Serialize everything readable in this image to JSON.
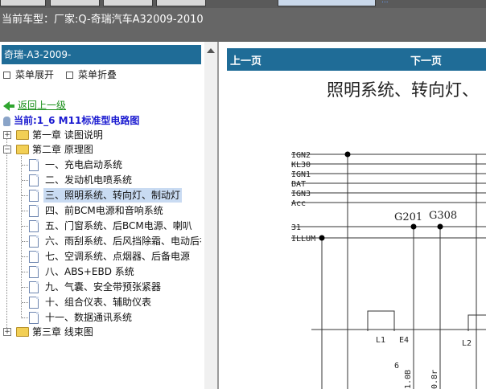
{
  "window": {
    "title": "当前车型：厂家:Q-奇瑞汽车A32009-2010",
    "top_link": "..."
  },
  "sidebar": {
    "header": "奇瑞-A3-2009-",
    "menu_expand": "菜单展开",
    "menu_collapse": "菜单折叠",
    "back_label": "返回上一级",
    "current_label": "当前:1_6 M11标准型电路图",
    "tree": [
      {
        "label": "第一章 读图说明",
        "type": "folder",
        "expanded": false
      },
      {
        "label": "第二章 原理图",
        "type": "folder",
        "expanded": true,
        "children": [
          {
            "label": "一、充电启动系统"
          },
          {
            "label": "二、发动机电喷系统"
          },
          {
            "label": "三、照明系统、转向灯、制动灯",
            "selected": true
          },
          {
            "label": "四、前BCM电源和音响系统"
          },
          {
            "label": "五、门窗系统、后BCM电源、喇叭"
          },
          {
            "label": "六、雨刮系统、后风挡除霜、电动后视"
          },
          {
            "label": "七、空调系统、点烟器、后备电源"
          },
          {
            "label": "八、ABS+EBD 系统"
          },
          {
            "label": "九、气囊、安全带预张紧器"
          },
          {
            "label": "十、组合仪表、辅助仪表"
          },
          {
            "label": "十一、数据通讯系统"
          }
        ]
      },
      {
        "label": "第三章 线束图",
        "type": "folder",
        "expanded": false
      }
    ]
  },
  "viewer": {
    "prev_label": "上一页",
    "next_label": "下一页",
    "diagram_title": "照明系统、转向灯、",
    "signals": [
      "IGN2",
      "KL30",
      "IGN1",
      "BAT",
      "IGN3",
      "Acc",
      "31",
      "ILLUM"
    ],
    "grounds": [
      "G201",
      "G308"
    ],
    "connectors": [
      "L1",
      "E4",
      "L2"
    ],
    "wire_labels": [
      "6",
      "1.0B",
      "0.8r"
    ]
  }
}
